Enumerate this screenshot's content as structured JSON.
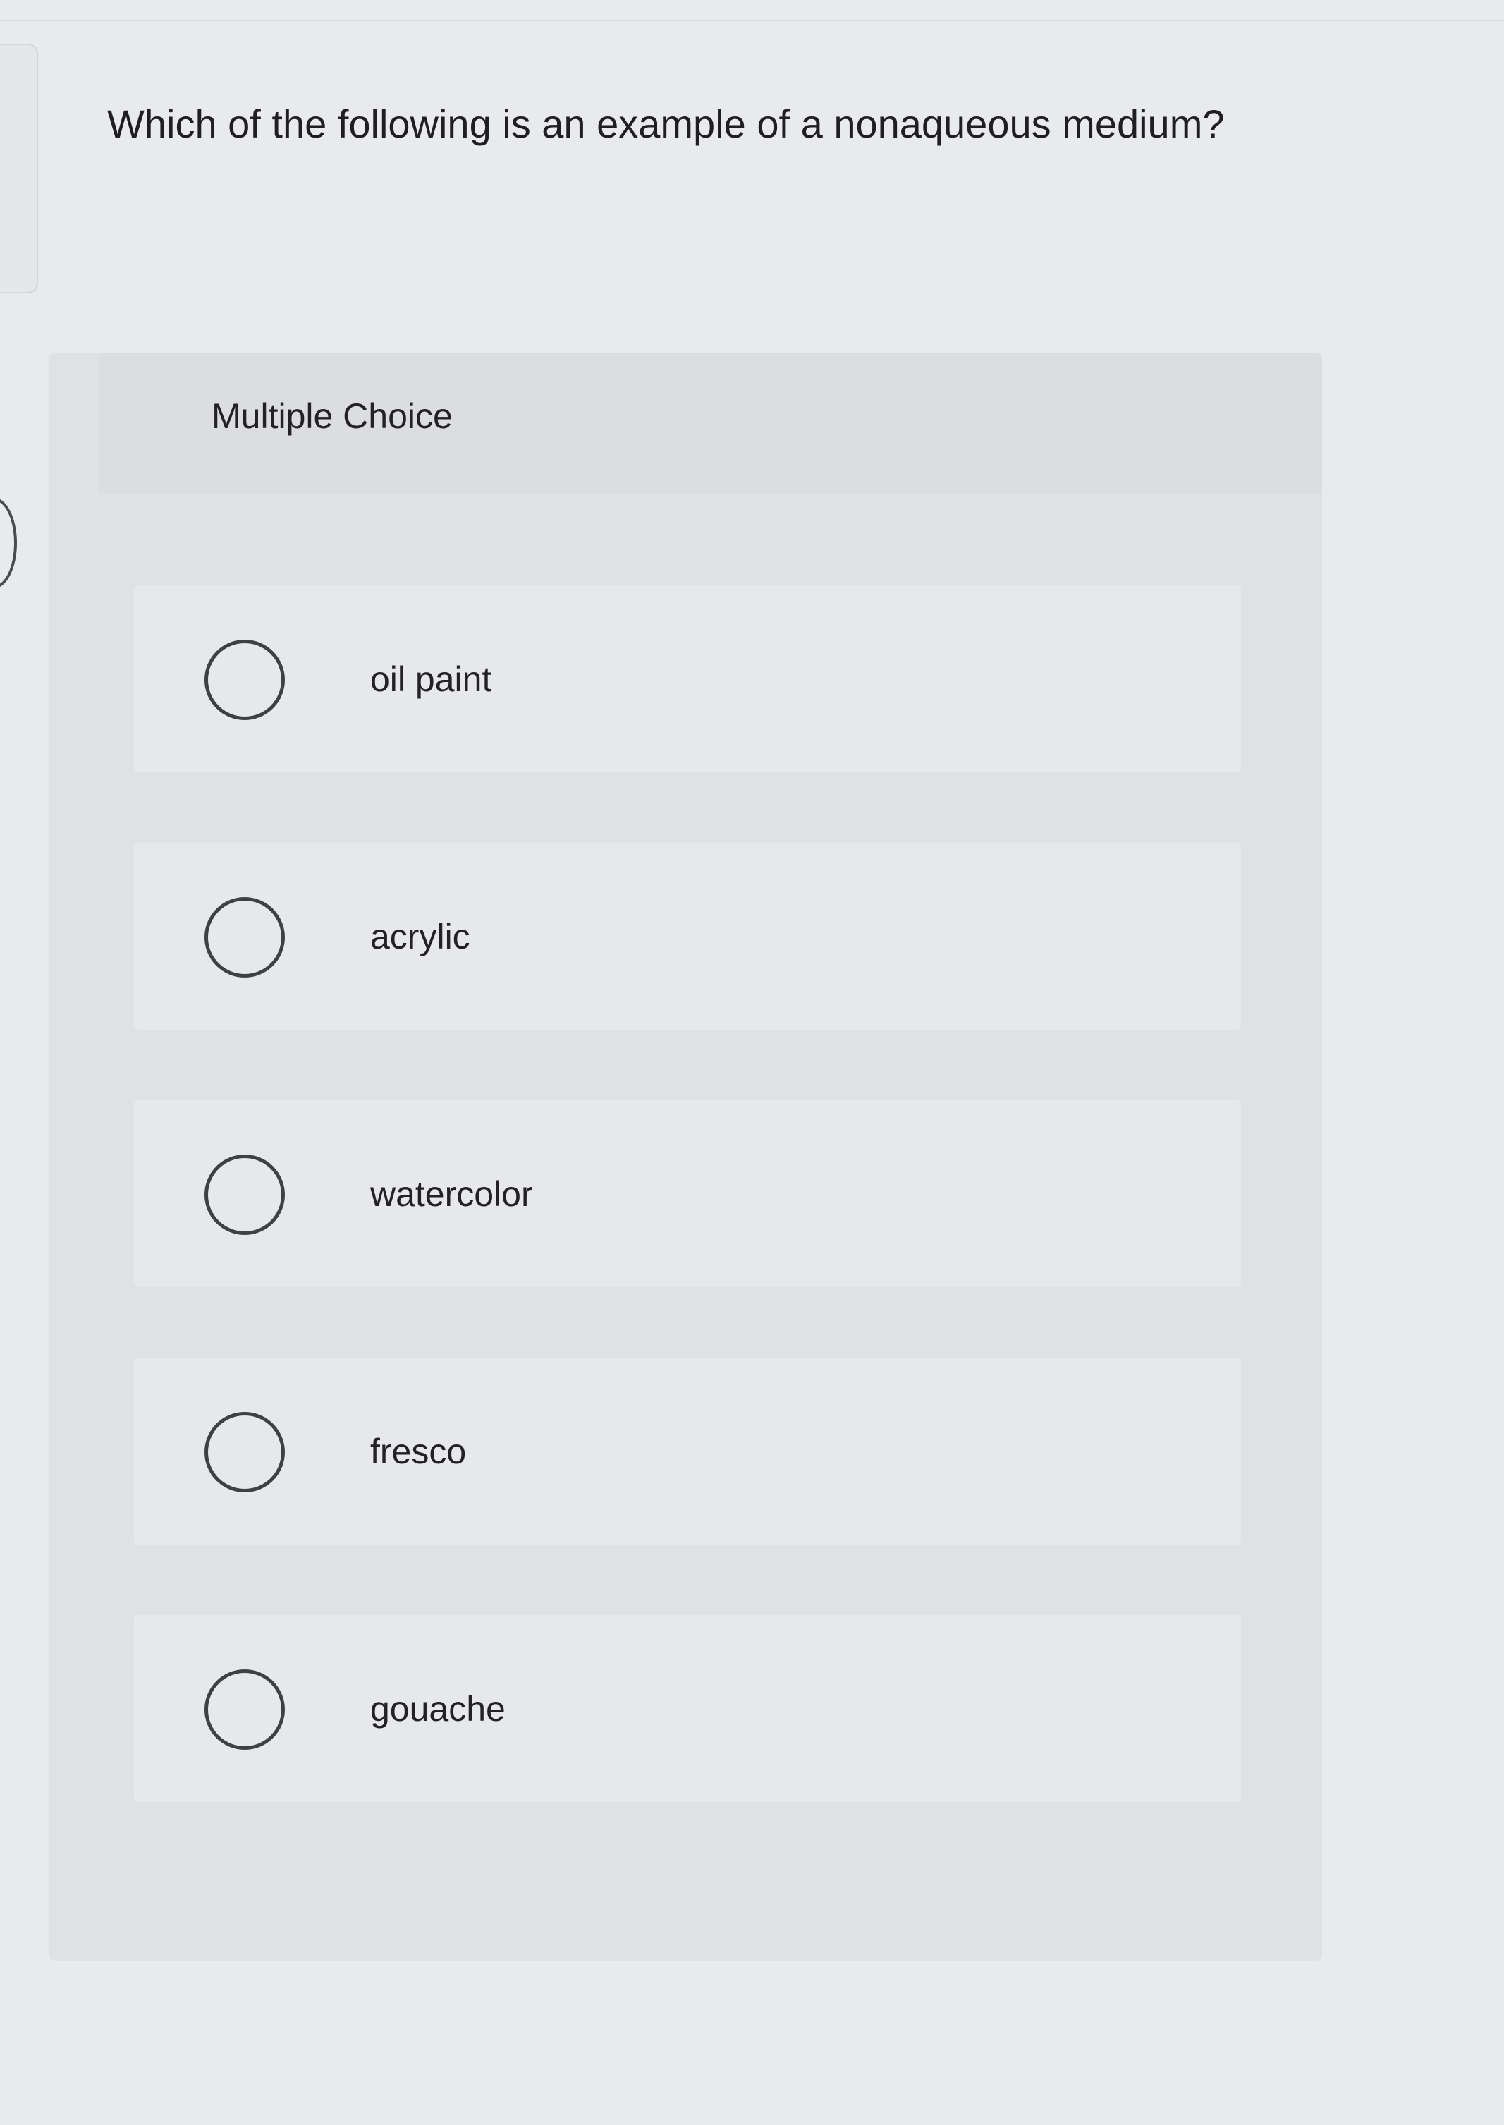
{
  "question": {
    "text": "Which of the following is an example of a nonaqueous medium?"
  },
  "card": {
    "label": "Multiple Choice"
  },
  "options": [
    {
      "label": "oil paint",
      "selected": false
    },
    {
      "label": "acrylic",
      "selected": false
    },
    {
      "label": "watercolor",
      "selected": false
    },
    {
      "label": "fresco",
      "selected": false
    },
    {
      "label": "gouache",
      "selected": false
    }
  ],
  "colors": {
    "background": "#e9eaec",
    "card": "#e0e1e4",
    "option": "#e7e8eb",
    "text": "#1e1e20",
    "radio_border": "#3f4044"
  }
}
